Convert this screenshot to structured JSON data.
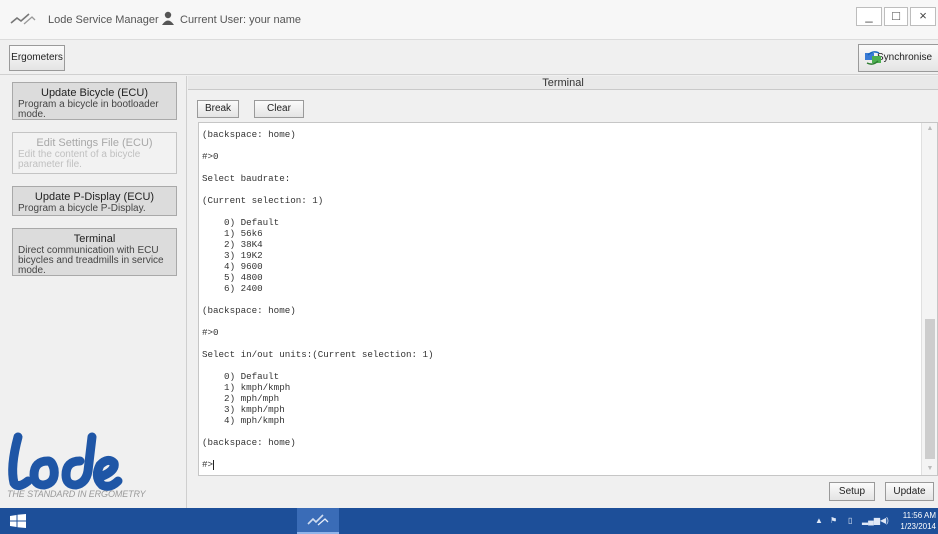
{
  "window": {
    "title": "Lode Service Manager",
    "user_label": "Current User: your name",
    "minimize_label": "_",
    "maximize_label": "□",
    "close_label": "×"
  },
  "toolbar": {
    "ergometers_label": "Ergometers",
    "synchronise_label": "Synchronise"
  },
  "sidebar": {
    "items": [
      {
        "title": "Update Bicycle (ECU)",
        "desc": "Program a bicycle in bootloader mode.",
        "enabled": true
      },
      {
        "title": "Edit Settings File (ECU)",
        "desc": "Edit the content of a bicycle parameter file.",
        "enabled": false
      },
      {
        "title": "Update P-Display (ECU)",
        "desc": "Program a bicycle P-Display.",
        "enabled": true
      },
      {
        "title": "Terminal",
        "desc": "Direct communication with ECU bicycles and treadmills in service mode.",
        "enabled": true
      }
    ],
    "tagline": "THE STANDARD IN ERGOMETRY"
  },
  "terminal": {
    "panel_title": "Terminal",
    "break_label": "Break",
    "clear_label": "Clear",
    "lines": [
      "(backspace: home)",
      "",
      "#>0",
      "",
      "Select baudrate:",
      "",
      "(Current selection: 1)",
      "",
      "    0) Default",
      "    1) 56k6",
      "    2) 38K4",
      "    3) 19K2",
      "    4) 9600",
      "    5) 4800",
      "    6) 2400",
      "",
      "(backspace: home)",
      "",
      "#>0",
      "",
      "Select in/out units:(Current selection: 1)",
      "",
      "    0) Default",
      "    1) kmph/kmph",
      "    2) mph/mph",
      "    3) kmph/mph",
      "    4) mph/kmph",
      "",
      "(backspace: home)",
      "",
      "#>"
    ],
    "setup_label": "Setup",
    "update_label": "Update"
  },
  "taskbar": {
    "time": "11:56 AM",
    "date": "1/23/2014"
  },
  "colors": {
    "taskbar": "#1d4f99",
    "logo_blue": "#1f56a6"
  }
}
